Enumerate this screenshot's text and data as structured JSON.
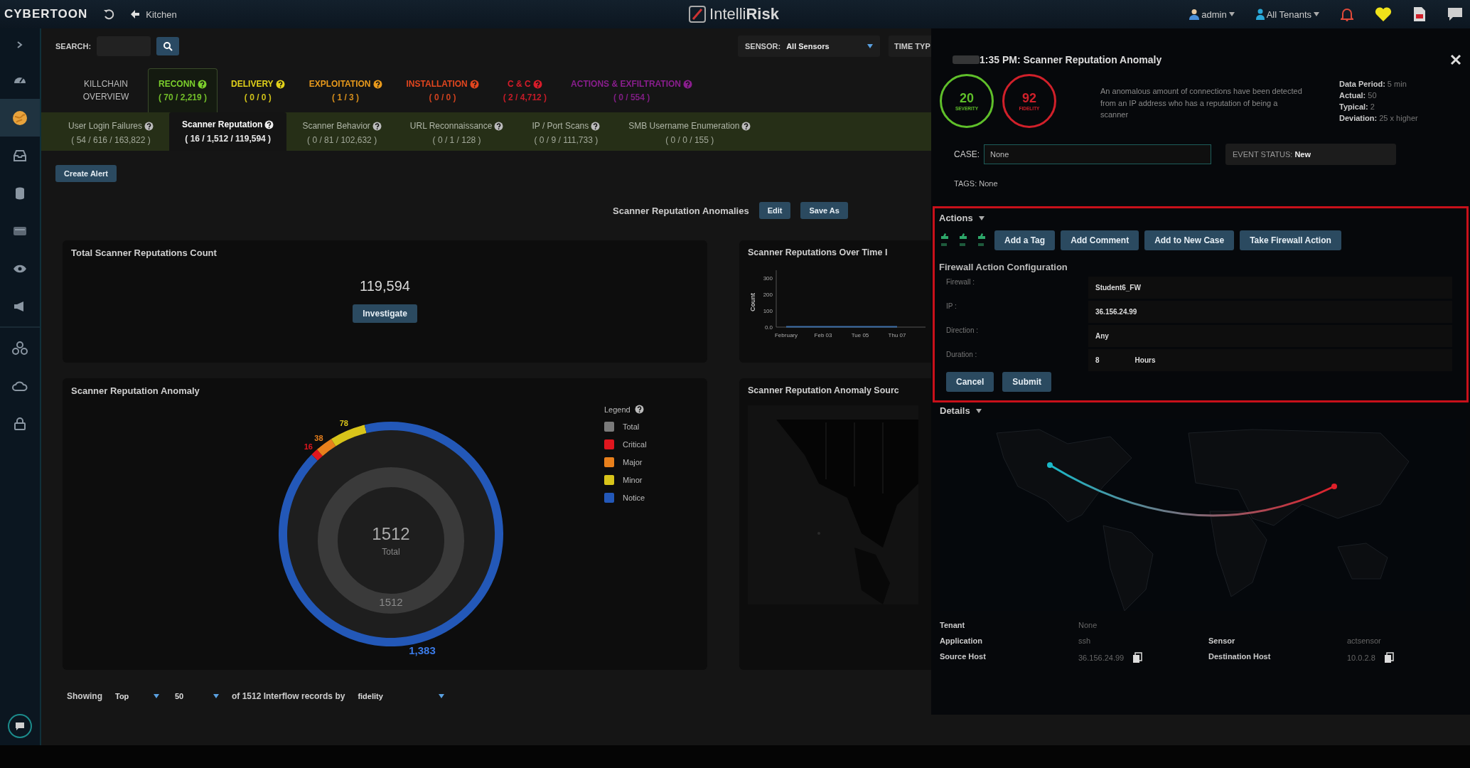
{
  "topbar": {
    "logo": "CYBERTOON",
    "breadcrumb": "Kitchen",
    "brand": "Intelli**Risk**",
    "user": "admin",
    "tenant": "All Tenants"
  },
  "sidebar": {
    "items": [
      {
        "selected": false
      },
      {
        "selected": true
      },
      {
        "selected": false
      },
      {
        "selected": false
      },
      {
        "selected": false
      },
      {
        "selected": false
      },
      {
        "selected": false
      },
      {
        "selected": false
      },
      {
        "selected": false
      },
      {
        "selected": false
      }
    ]
  },
  "search": {
    "label": "SEARCH:",
    "sensor_label": "SENSOR:",
    "sensor": "All Sensors",
    "time_type": "TIME TYP"
  },
  "killchain": [
    {
      "kind": "overview",
      "label": "KILLCHAIN OVERVIEW",
      "selected": false
    },
    {
      "kind": "stage",
      "label": "RECONN",
      "count": "( 70 / 2,219 )",
      "color": "#7ccf2c",
      "selected": true
    },
    {
      "kind": "stage",
      "label": "DELIVERY",
      "count": "( 0 / 0 )",
      "color": "#e2d21a",
      "selected": false
    },
    {
      "kind": "stage",
      "label": "EXPLOITATION",
      "count": "( 1 / 3 )",
      "color": "#e99a1c",
      "selected": false
    },
    {
      "kind": "stage",
      "label": "INSTALLATION",
      "count": "( 0 / 0 )",
      "color": "#e2461f",
      "selected": false
    },
    {
      "kind": "stage",
      "label": "C & C",
      "count": "( 2 / 4,712 )",
      "color": "#d81c2a",
      "selected": false
    },
    {
      "kind": "stage",
      "label": "ACTIONS & EXFILTRATION",
      "count": "( 0 / 554 )",
      "color": "#8a1e8e",
      "selected": false
    }
  ],
  "subtabs": [
    {
      "label": "User Login Failures",
      "count": "( 54 / 616 / 163,822 )",
      "selected": false
    },
    {
      "label": "Scanner Reputation",
      "count": "( 16 / 1,512 / 119,594 )",
      "selected": true
    },
    {
      "label": "Scanner Behavior",
      "count": "( 0 / 81 / 102,632 )",
      "selected": false
    },
    {
      "label": "URL Reconnaissance",
      "count": "( 0 / 1 / 128 )",
      "selected": false
    },
    {
      "label": "IP / Port Scans",
      "count": "( 0 / 9 / 111,733 )",
      "selected": false
    },
    {
      "label": "SMB Username Enumeration",
      "count": "( 0 / 0 / 155 )",
      "selected": false
    }
  ],
  "create_alert": "Create Alert",
  "dashboard": {
    "title": "Scanner Reputation Anomalies",
    "buttons": [
      "Edit",
      "Save As"
    ]
  },
  "count_card": {
    "title": "Total Scanner Reputations Count",
    "value": "119,594",
    "button": "Investigate"
  },
  "time_card": {
    "title": "Scanner Reputations Over Time I",
    "chart_data": {
      "type": "line",
      "ylabel": "Count",
      "categories": [
        "February",
        "Feb 03",
        "Tue 05",
        "Thu 07"
      ],
      "ylim": [
        0,
        350
      ],
      "yticks": [
        {
          "value": 0,
          "label": "0.0"
        },
        100,
        200,
        300
      ],
      "series": [
        {
          "color": "#3d6fa8",
          "values": [
            2,
            2,
            2,
            2
          ]
        }
      ]
    }
  },
  "anomaly_card": {
    "title": "Scanner Reputation Anomaly",
    "center_value": "1512",
    "center_label": "Total",
    "ring_label": "1512",
    "chart_data": {
      "type": "donut",
      "categories": [
        "Critical",
        "Major",
        "Minor",
        "Notice"
      ],
      "values": [
        16,
        38,
        78,
        1383
      ],
      "value_labels": [
        "16",
        "38",
        "78",
        "1,383"
      ]
    },
    "legend_title": "Legend",
    "legend_total": {
      "label": "Total",
      "color": "#7a7a7a"
    },
    "legend": [
      {
        "color": "#e0161e"
      },
      {
        "color": "#e8801c"
      },
      {
        "color": "#d8c41a"
      },
      {
        "color": "#2358b8"
      }
    ]
  },
  "source_card": {
    "title": "Scanner Reputation Anomaly Sourc"
  },
  "showing": {
    "label": "Showing",
    "order": "Top",
    "limit": "50",
    "middle": "of 1512 Interflow records by",
    "sort": "fidelity"
  },
  "panel": {
    "title": "1:35 PM: Scanner Reputation Anomaly",
    "scores": [
      {
        "value": "20",
        "label": "SEVERITY",
        "color": "#5fbf2a"
      },
      {
        "value": "92",
        "label": "FIDELITY",
        "color": "#d0202a"
      }
    ],
    "description": "An anomalous amount of connections have been detected from an IP address who has a reputation of being a scanner",
    "stats": [
      "**Data Period:** 5 min",
      "**Actual:** 50",
      "**Typical:** 2",
      "**Deviation:** 25 x higher"
    ],
    "case_label": "CASE:",
    "case": "None",
    "event_status": "EVENT STATUS: **New**",
    "tags": "TAGS: None",
    "actions_title": "Actions",
    "action_buttons": [
      "Add a Tag",
      "Add Comment",
      "Add to New Case",
      "Take Firewall Action"
    ],
    "firewall_title": "Firewall Action Configuration",
    "firewall": [
      {
        "label": "Firewall :",
        "value": "Student6_FW"
      },
      {
        "label": "IP :",
        "value": "36.156.24.99"
      },
      {
        "label": "Direction :",
        "value": "Any"
      },
      {
        "label": "Duration :",
        "value": "8",
        "unit": "Hours"
      }
    ],
    "firewall_buttons": [
      "Cancel",
      "Submit"
    ],
    "details_title": "Details",
    "details": [
      {
        "label": "Tenant",
        "value": "None"
      },
      {
        "label": "Application",
        "value": "ssh",
        "label2": "Sensor",
        "value2": "actsensor"
      },
      {
        "label": "Source Host",
        "value": "36.156.24.99",
        "copy": true,
        "label2": "Destination Host",
        "value2": "10.0.2.8",
        "copy2": true
      }
    ]
  }
}
